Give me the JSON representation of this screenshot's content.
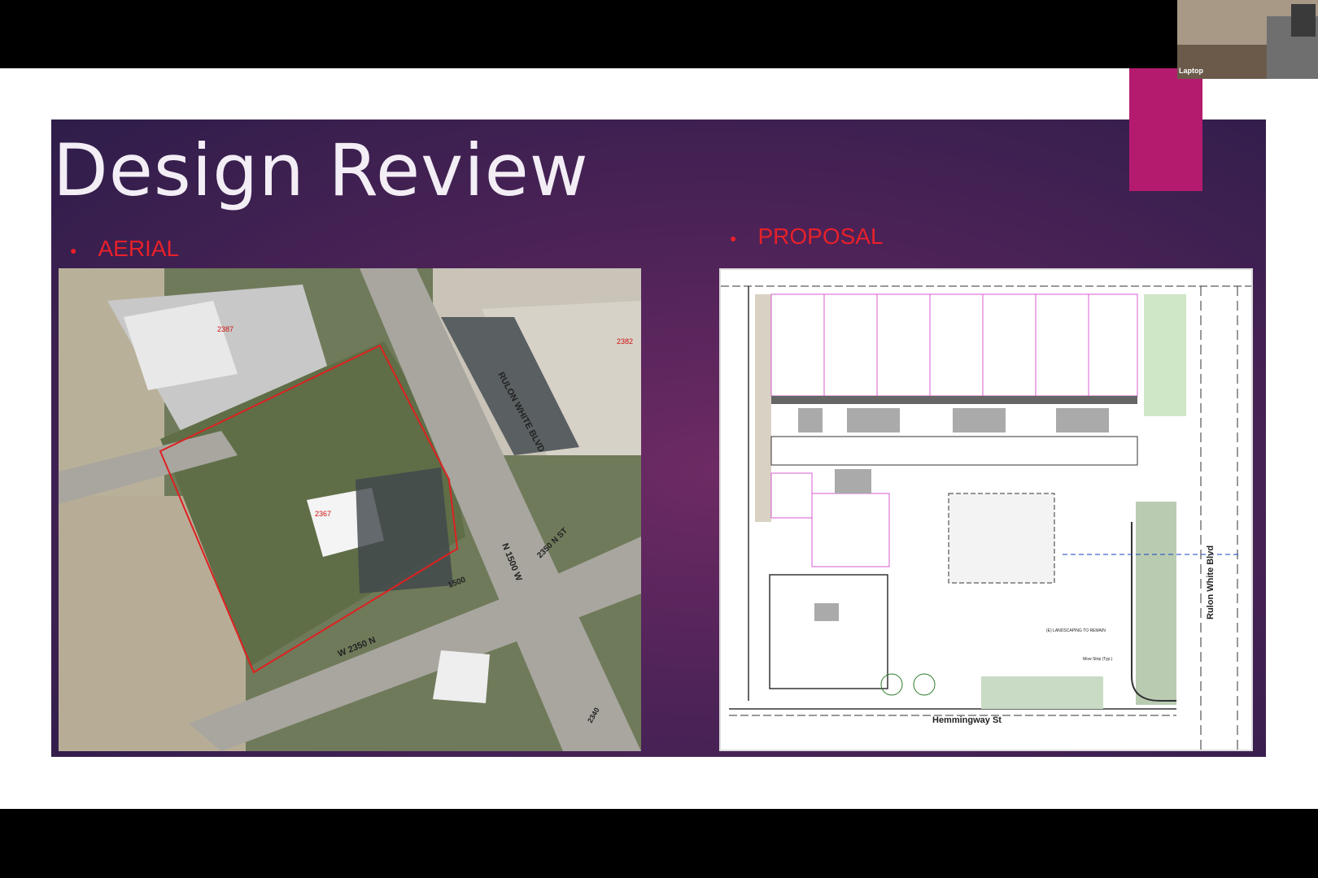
{
  "slide": {
    "title": "Design Review",
    "left_bullet": "AERIAL",
    "right_bullet": "PROPOSAL"
  },
  "aerial": {
    "road_labels": [
      "RULON WHITE BLVD",
      "N 1500 W",
      "W 2350 N",
      "2350 N ST",
      "1500"
    ],
    "parcel_labels": [
      "2387",
      "2382",
      "2367",
      "2340"
    ]
  },
  "proposal": {
    "street_bottom": "Hemmingway St",
    "street_right": "Rulon White Blvd",
    "note_landscaping": "(E) LANDSCAPING TO REMAIN",
    "note_mow_strip": "Mow Strip (Typ.)"
  },
  "webcam": {
    "label": "Laptop"
  },
  "colors": {
    "accent": "#b41b6e",
    "bullet_red": "#e8202a",
    "title": "#f3eef5"
  }
}
